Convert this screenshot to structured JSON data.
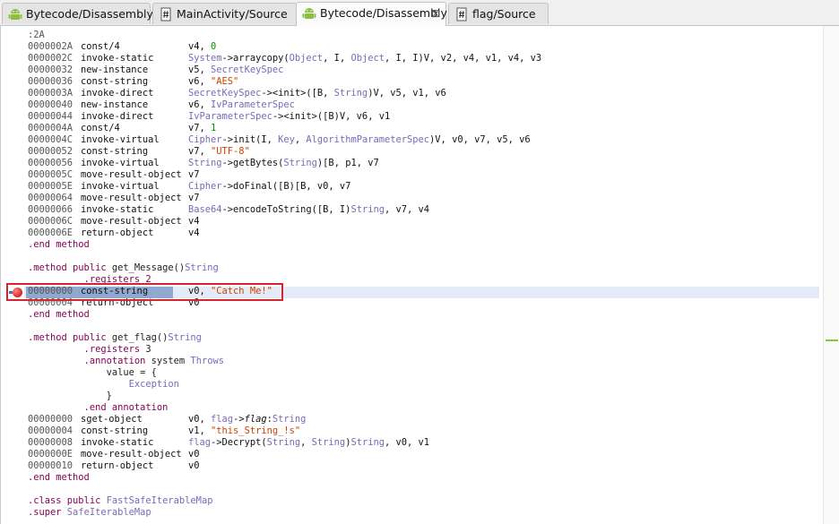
{
  "tabs": [
    {
      "label": "Bytecode/Disassembly",
      "icon": "android-icon",
      "active": false
    },
    {
      "label": "MainActivity/Source",
      "icon": "source-file-icon",
      "active": false
    },
    {
      "label": "Bytecode/Disassembly",
      "icon": "android-icon",
      "active": true,
      "close": "⊠"
    },
    {
      "label": "flag/Source",
      "icon": "source-file-icon",
      "active": false
    }
  ],
  "code_lines": [
    {
      "addr": ":2A",
      "op": "",
      "segs": []
    },
    {
      "addr": "0000002A",
      "op": "const/4",
      "segs": [
        [
          "v4, ",
          ""
        ],
        [
          "0",
          "nm"
        ]
      ]
    },
    {
      "addr": "0000002C",
      "op": "invoke-static",
      "segs": [
        [
          "System",
          "ty"
        ],
        [
          "->arraycopy(",
          ""
        ],
        [
          "Object",
          "ty"
        ],
        [
          ", I, ",
          ""
        ],
        [
          "Object",
          "ty"
        ],
        [
          ", I, I)V, v2, v4, v1, v4, v3",
          ""
        ]
      ]
    },
    {
      "addr": "00000032",
      "op": "new-instance",
      "segs": [
        [
          "v5, ",
          ""
        ],
        [
          "SecretKeySpec",
          "ty"
        ]
      ]
    },
    {
      "addr": "00000036",
      "op": "const-string",
      "segs": [
        [
          "v6, ",
          ""
        ],
        [
          "\"AES\"",
          "st"
        ]
      ]
    },
    {
      "addr": "0000003A",
      "op": "invoke-direct",
      "segs": [
        [
          "SecretKeySpec",
          "ty"
        ],
        [
          "-><init>([B, ",
          ""
        ],
        [
          "String",
          "ty"
        ],
        [
          ")V, v5, v1, v6",
          ""
        ]
      ]
    },
    {
      "addr": "00000040",
      "op": "new-instance",
      "segs": [
        [
          "v6, ",
          ""
        ],
        [
          "IvParameterSpec",
          "ty"
        ]
      ]
    },
    {
      "addr": "00000044",
      "op": "invoke-direct",
      "segs": [
        [
          "IvParameterSpec",
          "ty"
        ],
        [
          "-><init>([B)V, v6, v1",
          ""
        ]
      ]
    },
    {
      "addr": "0000004A",
      "op": "const/4",
      "segs": [
        [
          "v7, ",
          ""
        ],
        [
          "1",
          "nm"
        ]
      ]
    },
    {
      "addr": "0000004C",
      "op": "invoke-virtual",
      "segs": [
        [
          "Cipher",
          "ty"
        ],
        [
          "->init(I, ",
          ""
        ],
        [
          "Key",
          "ty"
        ],
        [
          ", ",
          ""
        ],
        [
          "AlgorithmParameterSpec",
          "ty"
        ],
        [
          ")V, v0, v7, v5, v6",
          ""
        ]
      ]
    },
    {
      "addr": "00000052",
      "op": "const-string",
      "segs": [
        [
          "v7, ",
          ""
        ],
        [
          "\"UTF-8\"",
          "st"
        ]
      ]
    },
    {
      "addr": "00000056",
      "op": "invoke-virtual",
      "segs": [
        [
          "String",
          "ty"
        ],
        [
          "->getBytes(",
          ""
        ],
        [
          "String",
          "ty"
        ],
        [
          ")[B, p1, v7",
          ""
        ]
      ]
    },
    {
      "addr": "0000005C",
      "op": "move-result-object",
      "segs": [
        [
          "v7",
          ""
        ]
      ]
    },
    {
      "addr": "0000005E",
      "op": "invoke-virtual",
      "segs": [
        [
          "Cipher",
          "ty"
        ],
        [
          "->doFinal([B)[B, v0, v7",
          ""
        ]
      ]
    },
    {
      "addr": "00000064",
      "op": "move-result-object",
      "segs": [
        [
          "v7",
          ""
        ]
      ]
    },
    {
      "addr": "00000066",
      "op": "invoke-static",
      "segs": [
        [
          "Base64",
          "ty"
        ],
        [
          "->encodeToString([B, I)",
          ""
        ],
        [
          "String",
          "ty"
        ],
        [
          ", v7, v4",
          ""
        ]
      ]
    },
    {
      "addr": "0000006C",
      "op": "move-result-object",
      "segs": [
        [
          "v4",
          ""
        ]
      ]
    },
    {
      "addr": "0000006E",
      "op": "return-object",
      "segs": [
        [
          "v4",
          ""
        ]
      ]
    },
    {
      "raw": [
        [
          ".end method",
          "dir"
        ]
      ]
    },
    {
      "raw": []
    },
    {
      "raw": [
        [
          ".method public ",
          "dir"
        ],
        [
          "get_Message()",
          ""
        ],
        [
          "String",
          "ty"
        ]
      ]
    },
    {
      "raw": [
        [
          "          .registers 2",
          "dir"
        ]
      ]
    },
    {
      "addr": "00000000",
      "op": "const-string",
      "segs": [
        [
          "v0, ",
          ""
        ],
        [
          "\"Catch Me!\"",
          "st"
        ]
      ]
    },
    {
      "addr": "00000004",
      "op": "return-object",
      "segs": [
        [
          "v0",
          ""
        ]
      ]
    },
    {
      "raw": [
        [
          ".end method",
          "dir"
        ]
      ]
    },
    {
      "raw": []
    },
    {
      "raw": [
        [
          ".method public ",
          "dir"
        ],
        [
          "get_flag()",
          ""
        ],
        [
          "String",
          "ty"
        ]
      ]
    },
    {
      "raw": [
        [
          "          .registers ",
          "dir"
        ],
        [
          "3",
          ""
        ]
      ]
    },
    {
      "raw": [
        [
          "          .annotation ",
          "dir"
        ],
        [
          "system ",
          ""
        ],
        [
          "Throws",
          "ty"
        ]
      ]
    },
    {
      "raw": [
        [
          "              value = {",
          ""
        ]
      ]
    },
    {
      "raw": [
        [
          "                  Exception",
          "ty"
        ]
      ]
    },
    {
      "raw": [
        [
          "              }",
          ""
        ]
      ]
    },
    {
      "raw": [
        [
          "          .end annotation",
          "dir"
        ]
      ]
    },
    {
      "addr": "00000000",
      "op": "sget-object",
      "segs": [
        [
          "v0, ",
          ""
        ],
        [
          "flag",
          "ty"
        ],
        [
          "->",
          ""
        ],
        [
          "flag",
          "it"
        ],
        [
          ":",
          ""
        ],
        [
          "String",
          "ty"
        ]
      ]
    },
    {
      "addr": "00000004",
      "op": "const-string",
      "segs": [
        [
          "v1, ",
          ""
        ],
        [
          "\"this_String_!s\"",
          "st"
        ]
      ]
    },
    {
      "addr": "00000008",
      "op": "invoke-static",
      "segs": [
        [
          "flag",
          "ty"
        ],
        [
          "->Decrypt(",
          ""
        ],
        [
          "String",
          "ty"
        ],
        [
          ", ",
          ""
        ],
        [
          "String",
          "ty"
        ],
        [
          ")",
          ""
        ],
        [
          "String",
          "ty"
        ],
        [
          ", v0, v1",
          ""
        ]
      ]
    },
    {
      "addr": "0000000E",
      "op": "move-result-object",
      "segs": [
        [
          "v0",
          ""
        ]
      ]
    },
    {
      "addr": "00000010",
      "op": "return-object",
      "segs": [
        [
          "v0",
          ""
        ]
      ]
    },
    {
      "raw": [
        [
          ".end method",
          "dir"
        ]
      ]
    },
    {
      "raw": []
    },
    {
      "raw": [
        [
          ".class public ",
          "dir"
        ],
        [
          "FastSafeIterableMap",
          "ty"
        ]
      ]
    },
    {
      "raw": [
        [
          ".super ",
          "dir"
        ],
        [
          "SafeIterableMap",
          "ty"
        ]
      ]
    }
  ],
  "highlighted_line_index": 22,
  "colors": {
    "breakpoint": "#d61f1f",
    "annotation_box": "#d8242b",
    "selection": "#8ea8cf"
  }
}
